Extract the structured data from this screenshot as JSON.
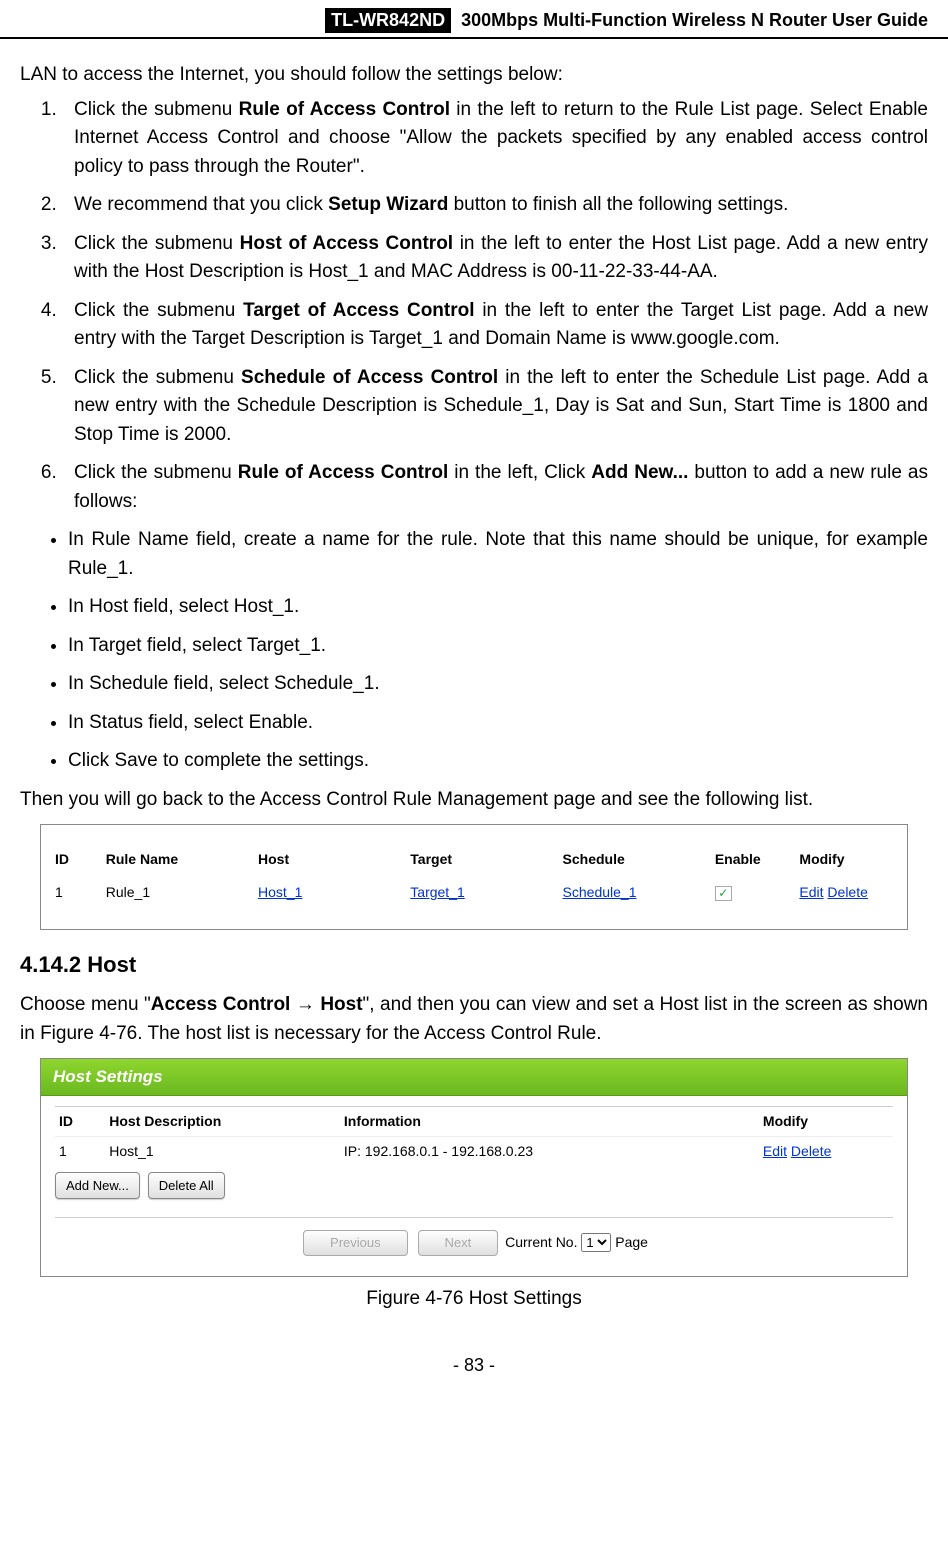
{
  "header": {
    "model": "TL-WR842ND",
    "title": "300Mbps Multi-Function Wireless N Router User Guide"
  },
  "intro": "LAN to access the Internet, you should follow the settings below:",
  "steps": {
    "s1a": "Click the submenu ",
    "s1b": "Rule of Access Control",
    "s1c": " in the left to return to the Rule List page. Select Enable Internet Access Control and choose \"Allow the packets specified by any enabled access control policy to pass through the Router\".",
    "s2a": "We recommend that you click ",
    "s2b": "Setup Wizard",
    "s2c": " button to finish all the following settings.",
    "s3a": "Click the submenu ",
    "s3b": "Host of Access Control",
    "s3c": " in the left to enter the Host List page. Add a new entry with the Host Description is Host_1 and MAC Address is 00-11-22-33-44-AA.",
    "s4a": "Click the submenu ",
    "s4b": "Target of Access Control",
    "s4c": " in the left to enter the Target List page. Add a new entry with the Target Description is Target_1 and Domain Name is www.google.com.",
    "s5a": "Click the submenu ",
    "s5b": "Schedule of Access Control",
    "s5c": " in the left to enter the Schedule List page. Add a new entry with the Schedule Description is Schedule_1, Day is Sat and Sun, Start Time is 1800 and Stop Time is 2000.",
    "s6a": "Click the submenu ",
    "s6b": "Rule of Access Control",
    "s6c": " in the left, Click ",
    "s6d": "Add New...",
    "s6e": " button to add a new rule as follows:"
  },
  "bullets": {
    "b1": "In Rule Name field, create a name for the rule. Note that this name should be unique, for example Rule_1.",
    "b2": "In Host field, select Host_1.",
    "b3": "In Target field, select Target_1.",
    "b4": "In Schedule field, select Schedule_1.",
    "b5": "In Status field, select Enable.",
    "b6": "Click Save to complete the settings."
  },
  "after_steps": "Then you will go back to the Access Control Rule Management page and see the following list.",
  "rule_table": {
    "headers": {
      "id": "ID",
      "rule_name": "Rule Name",
      "host": "Host",
      "target": "Target",
      "schedule": "Schedule",
      "enable": "Enable",
      "modify": "Modify"
    },
    "row": {
      "id": "1",
      "rule_name": "Rule_1",
      "host": "Host_1",
      "target": "Target_1",
      "schedule": "Schedule_1",
      "edit": "Edit",
      "delete": "Delete"
    }
  },
  "section": {
    "heading": "4.14.2  Host",
    "p1a": "Choose menu \"",
    "p1b": "Access Control → Host",
    "p1c": "\", and then you can view and set a Host list in the screen as shown in Figure 4-76. The host list is necessary for the Access Control Rule."
  },
  "host_settings": {
    "title": "Host Settings",
    "headers": {
      "id": "ID",
      "desc": "Host Description",
      "info": "Information",
      "modify": "Modify"
    },
    "row": {
      "id": "1",
      "desc": "Host_1",
      "info": "IP: 192.168.0.1 - 192.168.0.23",
      "edit": "Edit",
      "delete": "Delete"
    },
    "buttons": {
      "add": "Add New...",
      "delete_all": "Delete All",
      "prev": "Previous",
      "next": "Next"
    },
    "pager": {
      "label1": "Current No.",
      "value": "1",
      "label2": "Page"
    }
  },
  "figure_caption": "Figure 4-76    Host Settings",
  "page_number": "- 83 -"
}
